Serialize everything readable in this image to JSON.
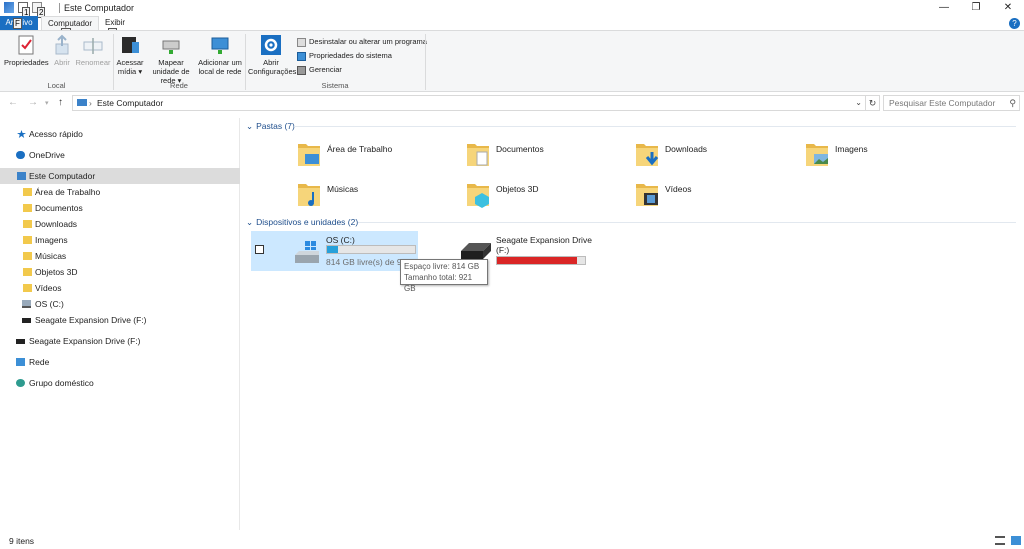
{
  "window": {
    "title": "Este Computador",
    "minimize": "—",
    "maximize": "❐",
    "close": "✕"
  },
  "ribbon_tabs": {
    "file": "Arquivo",
    "computer": "Computador",
    "view": "Exibir"
  },
  "keytips": {
    "qat1": "1",
    "qat2": "2",
    "computer": "C",
    "view": "V",
    "file": "F"
  },
  "ribbon": {
    "properties": "Propriedades",
    "open": "Abrir",
    "rename": "Renomear",
    "access_media": "Acessar mídia",
    "map_drive": "Mapear unidade de rede",
    "add_network": "Adicionar um local de rede",
    "open_settings": "Abrir Configurações",
    "uninstall": "Desinstalar ou alterar um programa",
    "system_props": "Propriedades do sistema",
    "manage": "Gerenciar",
    "group_local": "Local",
    "group_network": "Rede",
    "group_system": "Sistema"
  },
  "address": {
    "path": "Este Computador",
    "search_placeholder": "Pesquisar Este Computador"
  },
  "nav": {
    "quick_access": "Acesso rápido",
    "onedrive": "OneDrive",
    "this_pc": "Este Computador",
    "desktop": "Área de Trabalho",
    "documents": "Documentos",
    "downloads": "Downloads",
    "images": "Imagens",
    "music": "Músicas",
    "objects3d": "Objetos 3D",
    "videos": "Vídeos",
    "os_c": "OS (C:)",
    "seagate_sub": "Seagate Expansion Drive (F:)",
    "seagate": "Seagate Expansion Drive (F:)",
    "network": "Rede",
    "homegroup": "Grupo doméstico"
  },
  "folders_section": "Pastas (7)",
  "folders": [
    {
      "label": "Área de Trabalho"
    },
    {
      "label": "Documentos"
    },
    {
      "label": "Downloads"
    },
    {
      "label": "Imagens"
    },
    {
      "label": "Músicas"
    },
    {
      "label": "Objetos 3D"
    },
    {
      "label": "Vídeos"
    }
  ],
  "drives_section": "Dispositivos e unidades (2)",
  "drives": {
    "c": {
      "name": "OS (C:)",
      "free_text": "814 GB livre(s) de 921 GB",
      "used_fraction": 0.12
    },
    "f": {
      "name": "Seagate Expansion Drive",
      "letter": "(F:)",
      "used_fraction": 0.91
    }
  },
  "tooltip": {
    "free": "Espaço livre: 814 GB",
    "total": "Tamanho total: 921 GB"
  },
  "status": {
    "items": "9 itens"
  },
  "colors": {
    "accent": "#1a6fc2",
    "drive_ok": "#26a0da",
    "drive_full": "#da2626",
    "selection": "#cce8ff"
  }
}
